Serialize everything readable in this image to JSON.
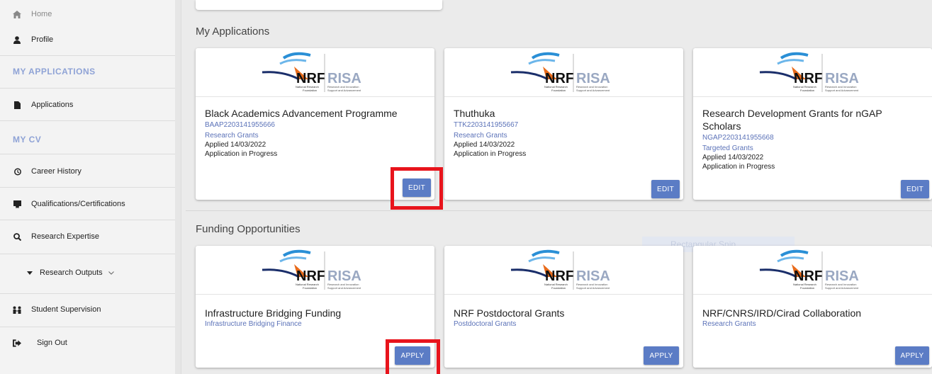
{
  "sidebar": {
    "home": "Home",
    "profile": "Profile",
    "my_applications_heading": "MY APPLICATIONS",
    "applications": "Applications",
    "my_cv_heading": "MY CV",
    "career_history": "Career History",
    "qualifications": "Qualifications/Certifications",
    "research_expertise": "Research Expertise",
    "research_outputs": "Research Outputs",
    "student_supervision": "Student Supervision",
    "sign_out": "Sign Out"
  },
  "logo": {
    "nrf": "NRF",
    "risa": "RISA",
    "nrf_sub_1": "National Research",
    "nrf_sub_2": "Foundation",
    "risa_sub_1": "Research and Innovation",
    "risa_sub_2": "Support and Advancement"
  },
  "my_applications": {
    "title": "My Applications",
    "cards": [
      {
        "title": "Black Academics Advancement Programme",
        "code": "BAAP2203141955666",
        "category": "Research Grants",
        "applied": "Applied 14/03/2022",
        "status": "Application in Progress",
        "button": "EDIT"
      },
      {
        "title": "Thuthuka",
        "code": "TTK2203141955667",
        "category": "Research Grants",
        "applied": "Applied 14/03/2022",
        "status": "Application in Progress",
        "button": "EDIT"
      },
      {
        "title": "Research Development Grants for nGAP Scholars",
        "code": "NGAP2203141955668",
        "category": "Targeted Grants",
        "applied": "Applied 14/03/2022",
        "status": "Application in Progress",
        "button": "EDIT"
      }
    ]
  },
  "funding": {
    "title": "Funding Opportunities",
    "cards": [
      {
        "title": "Infrastructure Bridging Funding",
        "category": "Infrastructure Bridging Finance",
        "button": "APPLY"
      },
      {
        "title": "NRF Postdoctoral Grants",
        "category": "Postdoctoral Grants",
        "button": "APPLY"
      },
      {
        "title": "NRF/CNRS/IRD/Cirad Collaboration",
        "category": "Research Grants",
        "button": "APPLY"
      }
    ]
  },
  "overlay": {
    "ghost_label": "Rectangular Snip"
  },
  "colors": {
    "accent": "#5b7cc5",
    "highlight": "#e8141c",
    "link": "#5b72b8",
    "heading": "#8fa3d6"
  }
}
